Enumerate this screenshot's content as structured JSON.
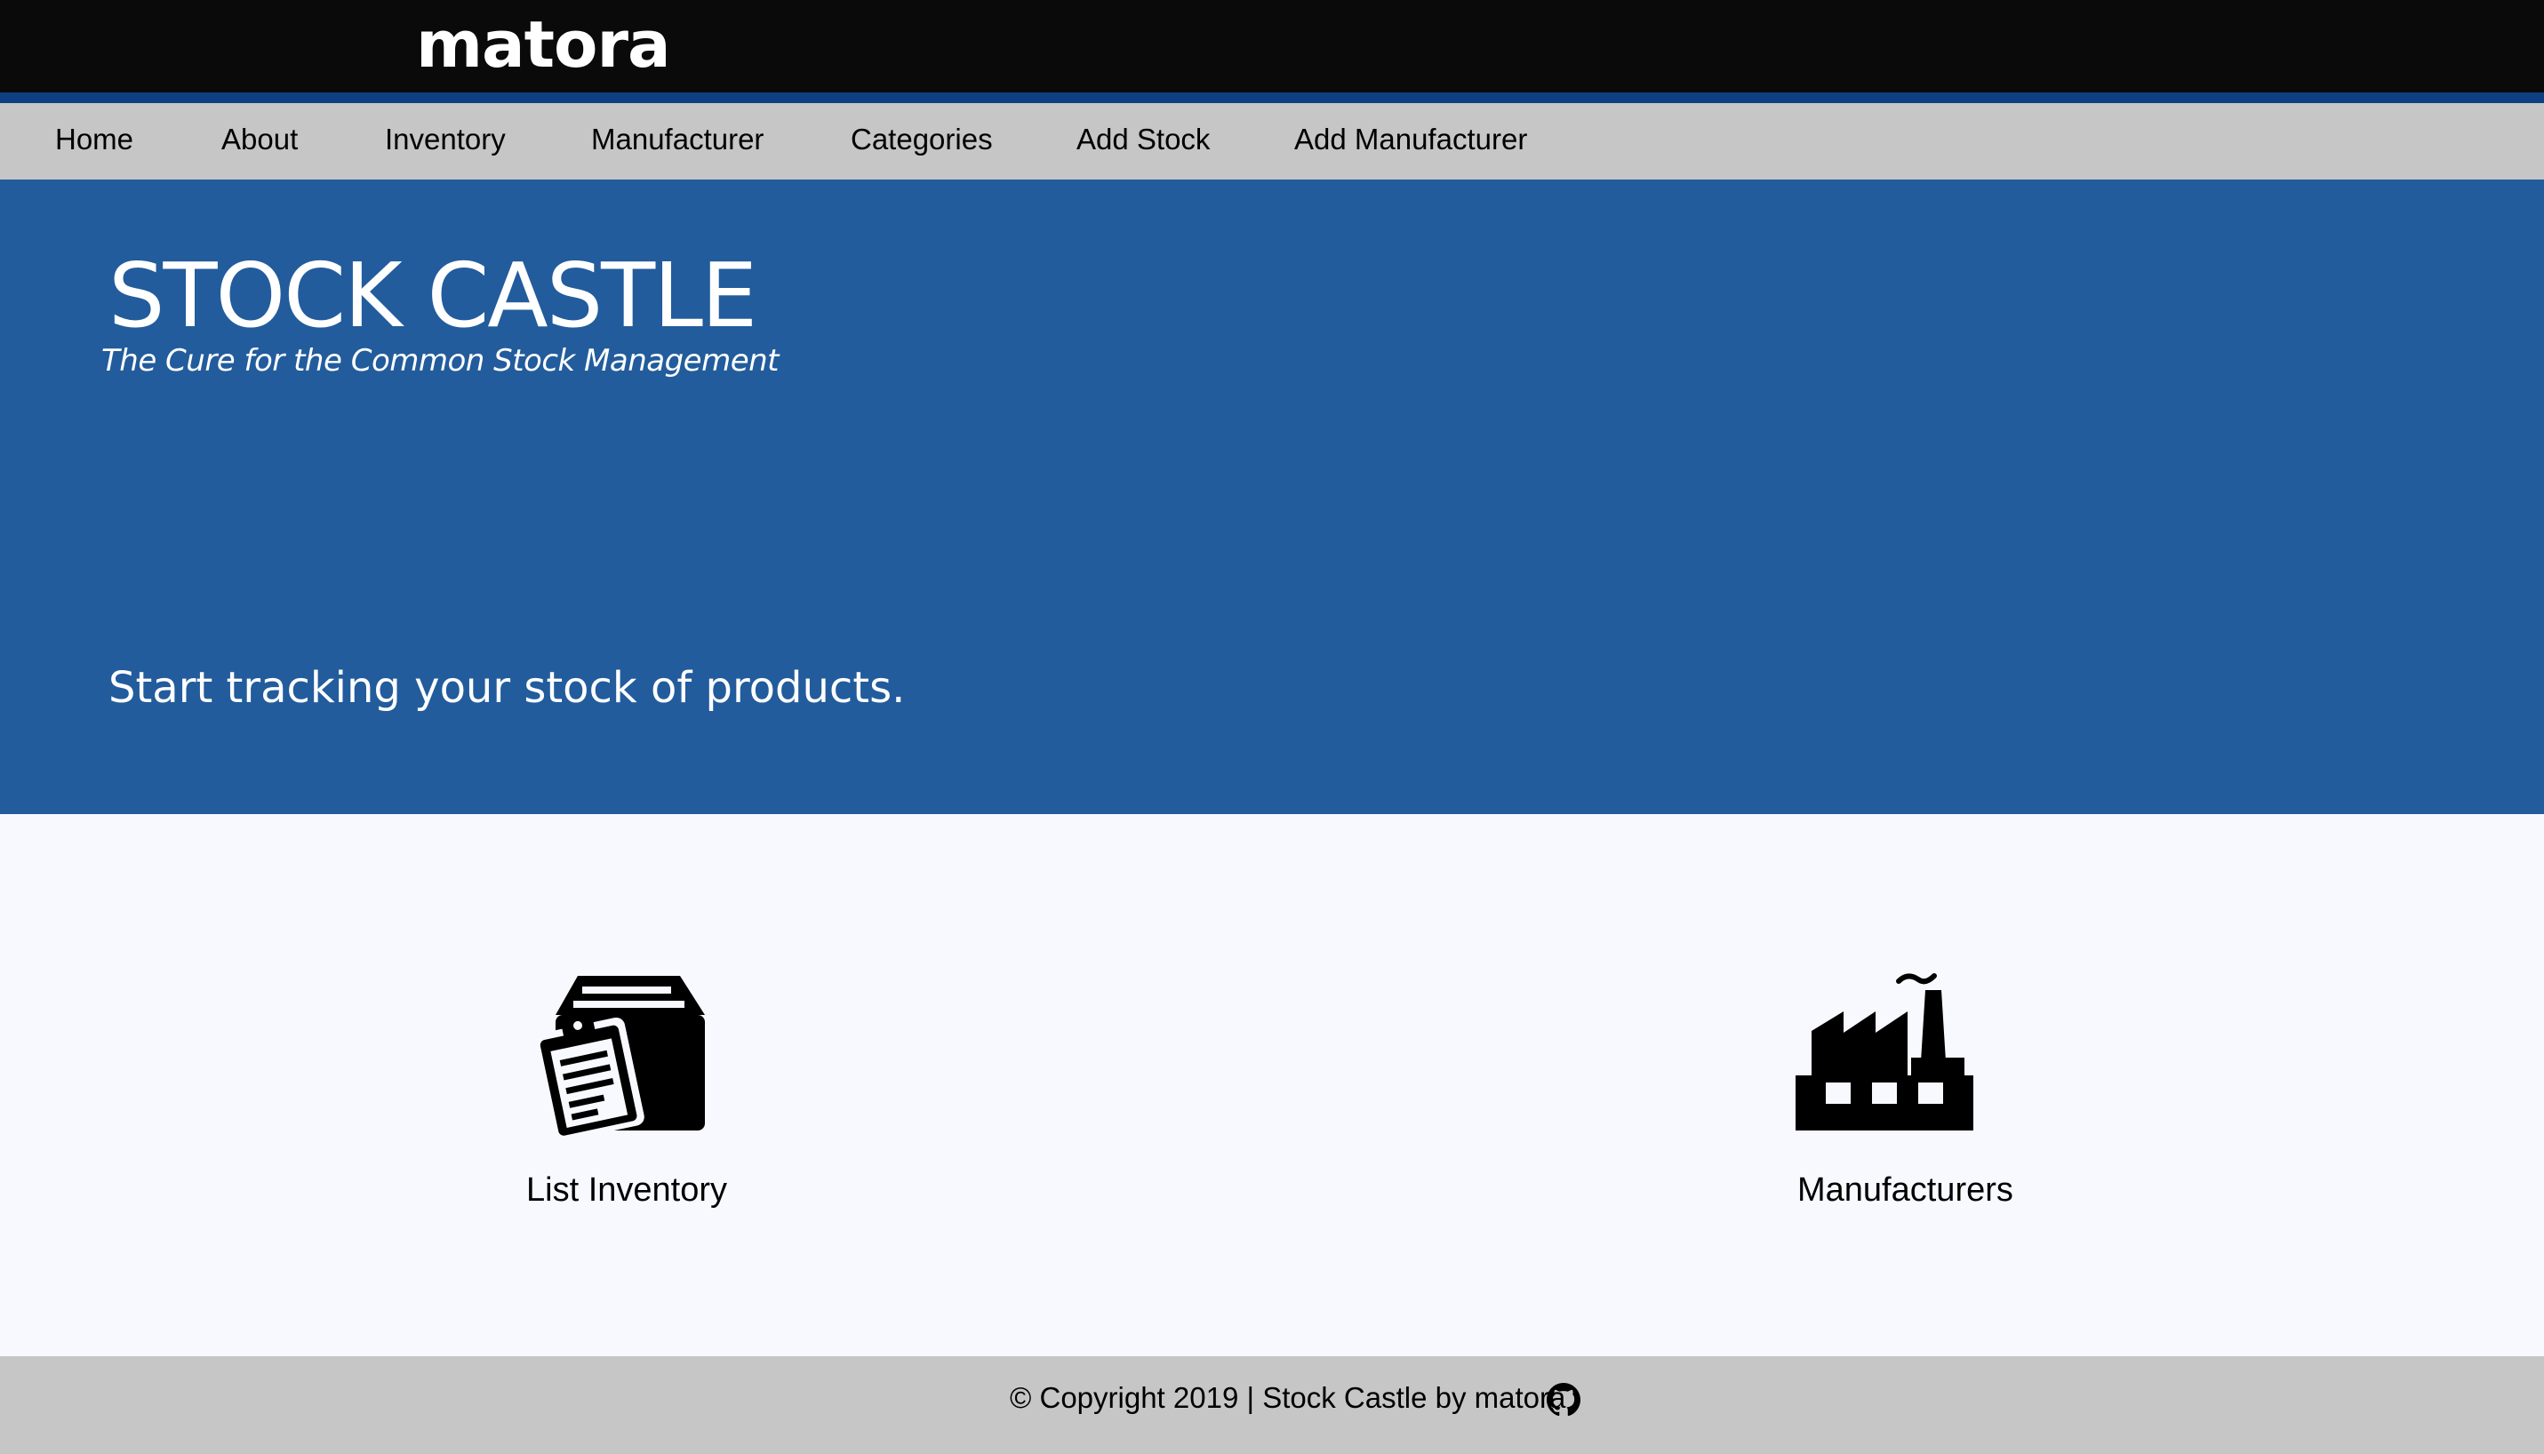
{
  "header": {
    "brand": "matora"
  },
  "nav": {
    "items": [
      {
        "label": "Home"
      },
      {
        "label": "About"
      },
      {
        "label": "Inventory"
      },
      {
        "label": "Manufacturer"
      },
      {
        "label": "Categories"
      },
      {
        "label": "Add Stock"
      },
      {
        "label": "Add Manufacturer"
      }
    ]
  },
  "hero": {
    "title": "STOCK CASTLE",
    "subtitle": "The Cure for the Common Stock Management",
    "tagline": "Start tracking your stock of products."
  },
  "cards": [
    {
      "label": "List Inventory",
      "icon": "inventory-box-clipboard-icon"
    },
    {
      "label": "Manufacturers",
      "icon": "factory-icon"
    }
  ],
  "footer": {
    "text": "© Copyright 2019 | Stock Castle by matora",
    "icon": "github-icon"
  },
  "colors": {
    "topbar": "#0a0a0a",
    "accent": "#0d3f82",
    "nav_bg": "#c6c6c6",
    "hero_bg": "#225c9c",
    "page_bg": "#f8f9ff"
  }
}
